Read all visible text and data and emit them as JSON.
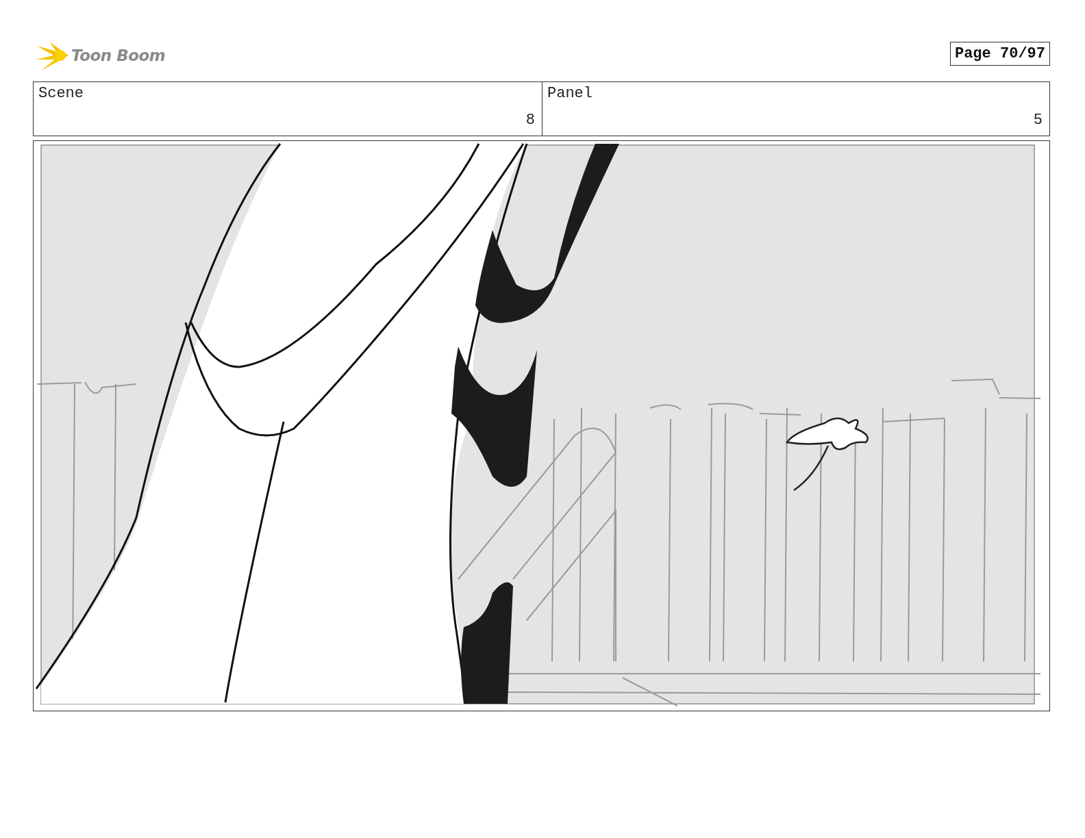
{
  "header": {
    "logo_text": "Toon Boom",
    "page_label": "Page 70/97"
  },
  "info": {
    "scene_heading": "Scene",
    "scene_number": "8",
    "panel_heading": "Panel",
    "panel_number": "5"
  },
  "panel": {
    "kind": "drawing"
  }
}
